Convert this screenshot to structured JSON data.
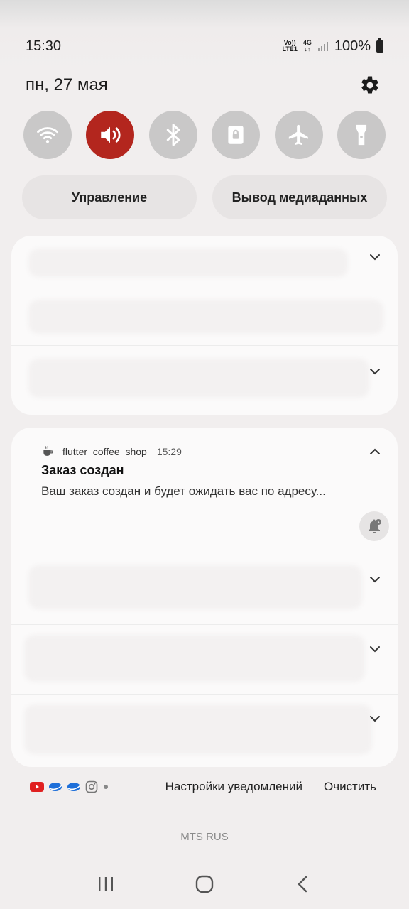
{
  "status": {
    "time": "15:30",
    "volte": "Vo)) LTE1",
    "net": "4G",
    "battery": "100%"
  },
  "header": {
    "date": "пн, 27 мая"
  },
  "quick_toggles": [
    {
      "icon": "wifi-icon",
      "active": false
    },
    {
      "icon": "sound-icon",
      "active": true
    },
    {
      "icon": "bluetooth-icon",
      "active": false
    },
    {
      "icon": "rotation-lock-icon",
      "active": false
    },
    {
      "icon": "airplane-icon",
      "active": false
    },
    {
      "icon": "flashlight-icon",
      "active": false
    }
  ],
  "pills": {
    "control": "Управление",
    "media_output": "Вывод медиаданных"
  },
  "notification": {
    "app": "flutter_coffee_shop",
    "time": "15:29",
    "title": "Заказ создан",
    "body": "Ваш заказ создан и будет ожидать вас по адресу..."
  },
  "footer": {
    "settings": "Настройки уведомлений",
    "clear": "Очистить"
  },
  "carrier": "MTS RUS",
  "colors": {
    "accent_red": "#b3261e",
    "toggle_off": "#c9c8c8"
  }
}
